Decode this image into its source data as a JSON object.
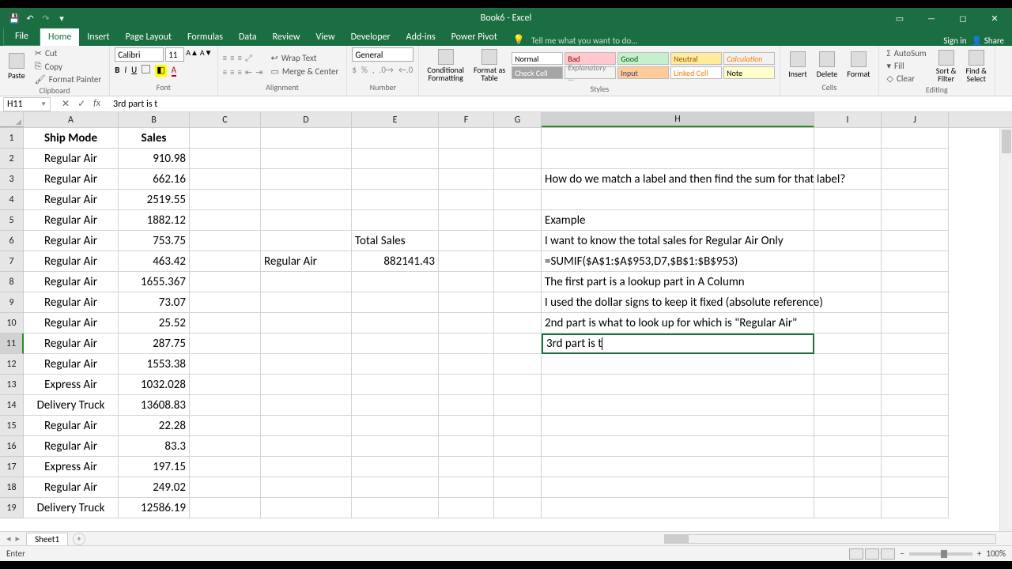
{
  "title": "Book6 - Excel",
  "tabs": {
    "file": "File",
    "items": [
      "Home",
      "Insert",
      "Page Layout",
      "Formulas",
      "Data",
      "Review",
      "View",
      "Developer",
      "Add-ins",
      "Power Pivot"
    ],
    "active": "Home",
    "tellme": "Tell me what you want to do...",
    "signin": "Sign in",
    "share": "Share"
  },
  "ribbon": {
    "clipboard": {
      "label": "Clipboard",
      "paste": "Paste",
      "cut": "Cut",
      "copy": "Copy",
      "formatpainter": "Format Painter"
    },
    "font": {
      "label": "Font",
      "name": "Calibri",
      "size": "11"
    },
    "alignment": {
      "label": "Alignment",
      "wrap": "Wrap Text",
      "merge": "Merge & Center"
    },
    "number": {
      "label": "Number",
      "format": "General"
    },
    "styles": {
      "label": "Styles",
      "cf": "Conditional\nFormatting",
      "fat": "Format as\nTable",
      "normal": "Normal",
      "bad": "Bad",
      "good": "Good",
      "neutral": "Neutral",
      "calc": "Calculation",
      "checkcell": "Check Cell",
      "explan": "Explanatory ...",
      "input": "Input",
      "linked": "Linked Cell",
      "note": "Note"
    },
    "cells": {
      "label": "Cells",
      "insert": "Insert",
      "delete": "Delete",
      "format": "Format"
    },
    "editing": {
      "label": "Editing",
      "autosum": "AutoSum",
      "fill": "Fill",
      "clear": "Clear",
      "sort": "Sort &\nFilter",
      "find": "Find &\nSelect"
    }
  },
  "formula_bar": {
    "ref": "H11",
    "content": "3rd part is t"
  },
  "columns": [
    "A",
    "B",
    "C",
    "D",
    "E",
    "F",
    "G",
    "H",
    "I",
    "J"
  ],
  "selected_col": "H",
  "selected_row": 11,
  "grid": {
    "A1": "Ship Mode",
    "B1": "Sales",
    "A2": "Regular Air",
    "B2": "910.98",
    "A3": "Regular Air",
    "B3": "662.16",
    "H3": "How do we match a label and then find the sum for that label?",
    "A4": "Regular Air",
    "B4": "2519.55",
    "A5": "Regular Air",
    "B5": "1882.12",
    "H5": "Example",
    "A6": "Regular Air",
    "B6": "753.75",
    "E6": "Total Sales",
    "H6": "I want to know the total sales for Regular Air Only",
    "A7": "Regular Air",
    "B7": "463.42",
    "D7": "Regular Air",
    "E7": "882141.43",
    "H7": "=SUMIF($A$1:$A$953,D7,$B$1:$B$953)",
    "A8": "Regular Air",
    "B8": "1655.367",
    "H8": "The first part is a lookup part in A Column",
    "A9": "Regular Air",
    "B9": "73.07",
    "H9": "I used the dollar signs to keep it fixed (absolute reference)",
    "A10": "Regular Air",
    "B10": "25.52",
    "H10": "2nd part is what to look up for which is \"Regular Air\"",
    "A11": "Regular Air",
    "B11": "287.75",
    "H11": "3rd part is t",
    "A12": "Regular Air",
    "B12": "1553.38",
    "A13": "Express Air",
    "B13": "1032.028",
    "A14": "Delivery Truck",
    "B14": "13608.83",
    "A15": "Regular Air",
    "B15": "22.28",
    "A16": "Regular Air",
    "B16": "83.3",
    "A17": "Express Air",
    "B17": "197.15",
    "A18": "Regular Air",
    "B18": "249.02",
    "A19": "Delivery Truck",
    "B19": "12586.19"
  },
  "sheet": {
    "name": "Sheet1"
  },
  "status": {
    "mode": "Enter",
    "zoom": "100%"
  },
  "chart_data": {
    "type": "table",
    "columns": [
      "Ship Mode",
      "Sales"
    ],
    "rows": [
      [
        "Regular Air",
        910.98
      ],
      [
        "Regular Air",
        662.16
      ],
      [
        "Regular Air",
        2519.55
      ],
      [
        "Regular Air",
        1882.12
      ],
      [
        "Regular Air",
        753.75
      ],
      [
        "Regular Air",
        463.42
      ],
      [
        "Regular Air",
        1655.367
      ],
      [
        "Regular Air",
        73.07
      ],
      [
        "Regular Air",
        25.52
      ],
      [
        "Regular Air",
        287.75
      ],
      [
        "Regular Air",
        1553.38
      ],
      [
        "Express Air",
        1032.028
      ],
      [
        "Delivery Truck",
        13608.83
      ],
      [
        "Regular Air",
        22.28
      ],
      [
        "Regular Air",
        83.3
      ],
      [
        "Express Air",
        197.15
      ],
      [
        "Regular Air",
        249.02
      ],
      [
        "Delivery Truck",
        12586.19
      ]
    ],
    "summary": {
      "label": "Total Sales",
      "criteria": "Regular Air",
      "value": 882141.43,
      "formula": "=SUMIF($A$1:$A$953,D7,$B$1:$B$953)"
    }
  }
}
